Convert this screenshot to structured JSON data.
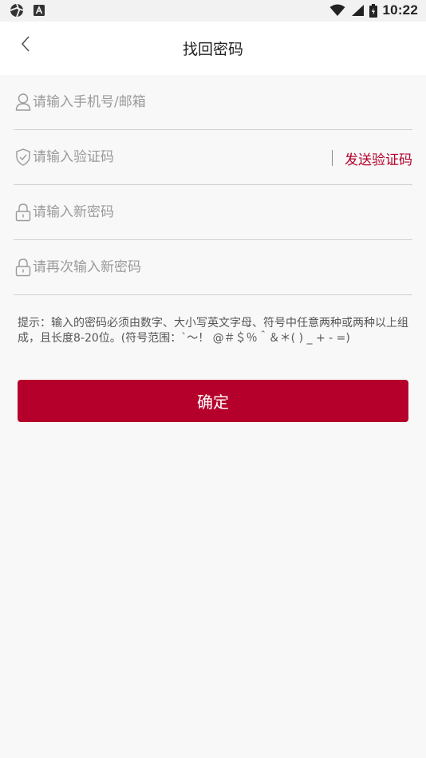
{
  "status_bar": {
    "time": "10:22",
    "left_icons": [
      "aperture-icon",
      "a-badge-icon"
    ],
    "right_icons": [
      "wifi-icon",
      "signal-icon",
      "battery-icon"
    ]
  },
  "header": {
    "title": "找回密码",
    "back_icon": "chevron-left-icon"
  },
  "form": {
    "account": {
      "placeholder": "请输入手机号/邮箱",
      "value": "",
      "icon": "user-icon"
    },
    "code": {
      "placeholder": "请输入验证码",
      "value": "",
      "icon": "shield-check-icon",
      "send_label": "发送验证码"
    },
    "new_password": {
      "placeholder": "请输入新密码",
      "value": "",
      "icon": "lock-icon"
    },
    "confirm_password": {
      "placeholder": "请再次输入新密码",
      "value": "",
      "icon": "lock-icon"
    }
  },
  "hint": "提示：输入的密码必须由数字、大小写英文字母、符号中任意两种或两种以上组成，且长度8-20位。(符号范围：`～！ @＃＄％＾＆＊( ) _ + - =)",
  "submit": {
    "label": "确定"
  },
  "colors": {
    "accent": "#b5002c",
    "background": "#f8f8f8",
    "divider": "#cfcfcf"
  }
}
